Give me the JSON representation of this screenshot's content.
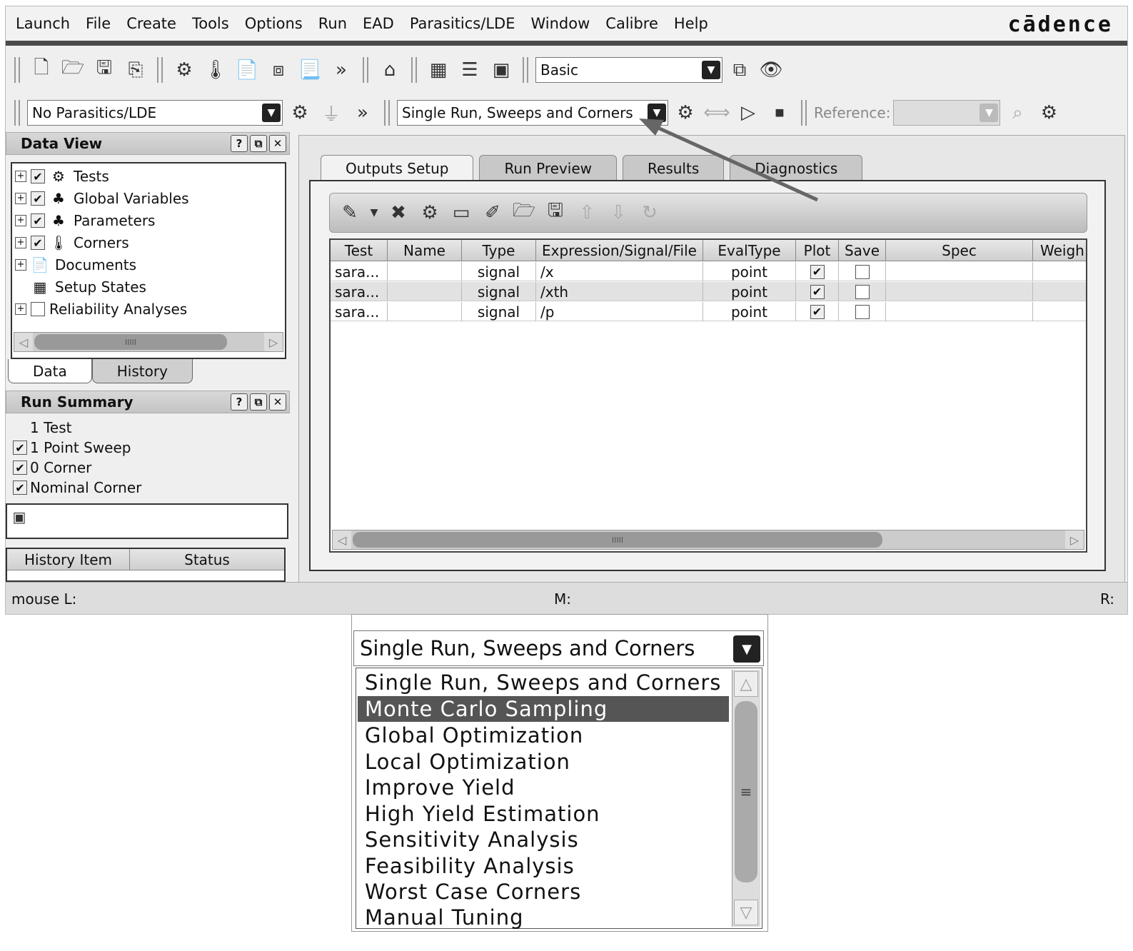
{
  "menu": [
    "Launch",
    "File",
    "Create",
    "Tools",
    "Options",
    "Run",
    "EAD",
    "Parasitics/LDE",
    "Window",
    "Calibre",
    "Help"
  ],
  "brand": "cādence",
  "toolbar": {
    "workspace_value": "Basic",
    "parasitics_value": "No Parasitics/LDE",
    "run_mode_value": "Single Run, Sweeps and Corners",
    "reference_label": "Reference:",
    "more": "»"
  },
  "data_view": {
    "title": "Data View",
    "btns": [
      "?",
      "⧉",
      "✕"
    ],
    "items": [
      {
        "label": "Tests",
        "checked": true
      },
      {
        "label": "Global Variables",
        "checked": true
      },
      {
        "label": "Parameters",
        "checked": true
      },
      {
        "label": "Corners",
        "checked": true
      },
      {
        "label": "Documents"
      },
      {
        "label": "Setup States"
      },
      {
        "label": "Reliability Analyses",
        "checked": false
      }
    ],
    "scroll_grip": "IIIII",
    "tabs": [
      "Data",
      "History"
    ]
  },
  "run_summary": {
    "title": "Run Summary",
    "items": [
      {
        "label": "1 Test"
      },
      {
        "label": "1 Point Sweep",
        "checked": true
      },
      {
        "label": "0 Corner",
        "checked": true
      },
      {
        "label": "Nominal Corner",
        "checked": true
      }
    ],
    "history_columns": [
      "History Item",
      "Status"
    ]
  },
  "main_tabs": [
    "Outputs Setup",
    "Run Preview",
    "Results",
    "Diagnostics"
  ],
  "outputs": {
    "columns": [
      "Test",
      "Name",
      "Type",
      "Expression/Signal/File",
      "EvalType",
      "Plot",
      "Save",
      "Spec",
      "Weigh"
    ],
    "rows": [
      {
        "test": "sara...",
        "name": "",
        "type": "signal",
        "expr": "/x",
        "eval": "point",
        "plot": "✔",
        "save": ""
      },
      {
        "test": "sara...",
        "name": "",
        "type": "signal",
        "expr": "/xth",
        "eval": "point",
        "plot": "✔",
        "save": ""
      },
      {
        "test": "sara...",
        "name": "",
        "type": "signal",
        "expr": "/p",
        "eval": "point",
        "plot": "✔",
        "save": ""
      }
    ],
    "scroll_grip": "IIIII"
  },
  "status_bar": {
    "left": "mouse L:",
    "mid": "M:",
    "right": "R:"
  },
  "dropdown": {
    "current": "Single Run, Sweeps and Corners",
    "options": [
      "Single Run, Sweeps and Corners",
      "Monte Carlo Sampling",
      "Global Optimization",
      "Local Optimization",
      "Improve Yield",
      "High Yield Estimation",
      "Sensitivity Analysis",
      "Feasibility Analysis",
      "Worst Case Corners",
      "Manual Tuning"
    ],
    "selected_index": 1
  }
}
